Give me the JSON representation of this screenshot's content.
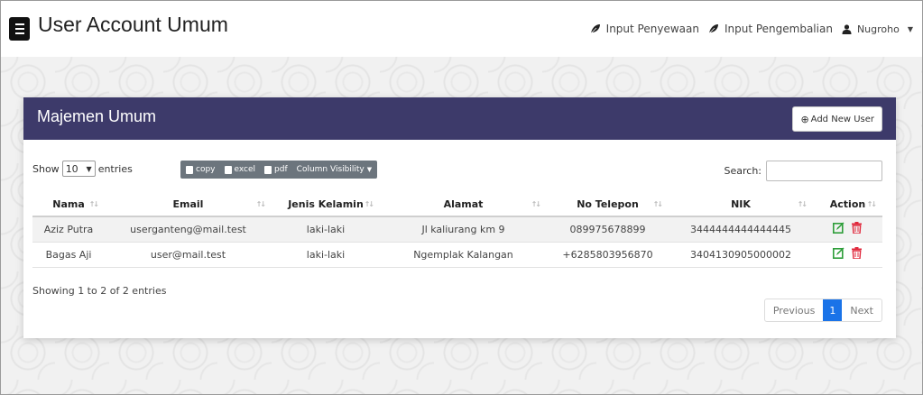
{
  "header": {
    "title": "User Account Umum",
    "nav": [
      {
        "label": "Input Penyewaan",
        "icon": "leaf-icon"
      },
      {
        "label": "Input Pengembalian",
        "icon": "leaf-icon"
      }
    ],
    "user": {
      "label": "Nugroho",
      "icon": "user-icon"
    }
  },
  "card": {
    "title": "Majemen Umum",
    "add_button": "Add New User",
    "header_color": "#3d3a6a"
  },
  "controls": {
    "show_label": "Show",
    "entries_value": "10",
    "entries_label": "entries",
    "buttons": {
      "copy": "copy",
      "excel": "excel",
      "pdf": "pdf",
      "column_visibility": "Column Visibility"
    },
    "search_label": "Search:"
  },
  "table": {
    "columns": [
      "Nama",
      "Email",
      "Jenis Kelamin",
      "Alamat",
      "No Telepon",
      "NIK",
      "Action"
    ],
    "rows": [
      [
        "Aziz Putra",
        "userganteng@mail.test",
        "laki-laki",
        "Jl kaliurang km 9",
        "089975678899",
        "3444444444444445"
      ],
      [
        "Bagas Aji",
        "user@mail.test",
        "laki-laki",
        "Ngemplak Kalangan",
        "+6285803956870",
        "3404130905000002"
      ]
    ]
  },
  "footer": {
    "info": "Showing 1 to 2 of 2 entries",
    "pagination": {
      "previous": "Previous",
      "current": "1",
      "next": "Next"
    }
  }
}
